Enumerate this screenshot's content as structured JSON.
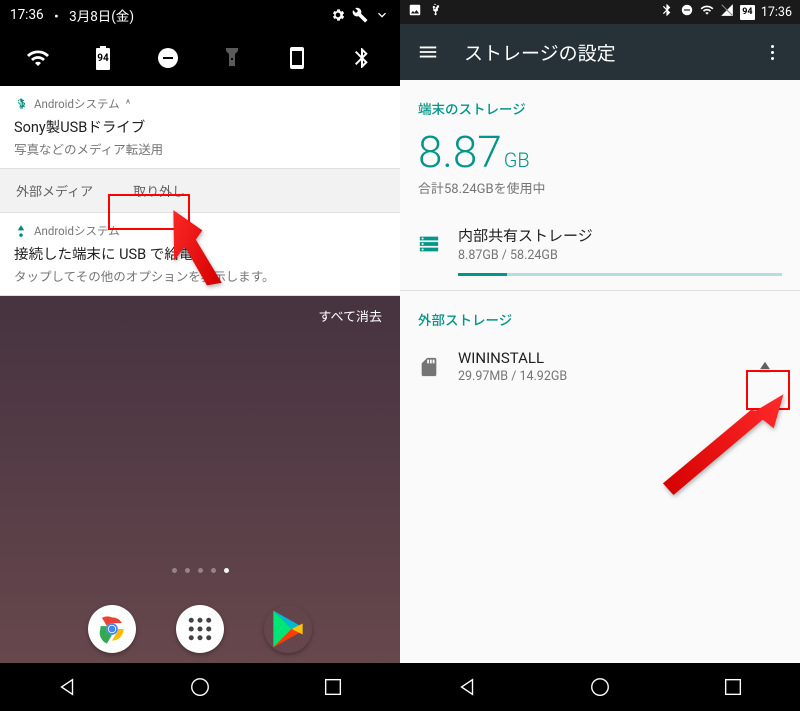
{
  "left": {
    "status": {
      "time": "17:36",
      "sep": "・",
      "date": "3月8日(金)"
    },
    "battery": "94",
    "notif1": {
      "app": "Androidシステム",
      "title": "Sony製USBドライブ",
      "body": "写真などのメディア転送用",
      "action1": "外部メディア",
      "action2": "取り外し"
    },
    "notif2": {
      "app": "Androidシステム",
      "title": "接続した端末に USB で給電",
      "body": "タップしてその他のオプションを表示します。"
    },
    "clear_all": "すべて消去"
  },
  "right": {
    "time": "17:36",
    "battery": "94",
    "appbar_title": "ストレージの設定",
    "sec1_hdr": "端末のストレージ",
    "big_val": "8.87",
    "big_unit": "GB",
    "sub": "合計58.24GBを使用中",
    "internal": {
      "name": "内部共有ストレージ",
      "detail": "8.87GB / 58.24GB"
    },
    "sec2_hdr": "外部ストレージ",
    "external": {
      "name": "WININSTALL",
      "detail": "29.97MB / 14.92GB"
    }
  }
}
